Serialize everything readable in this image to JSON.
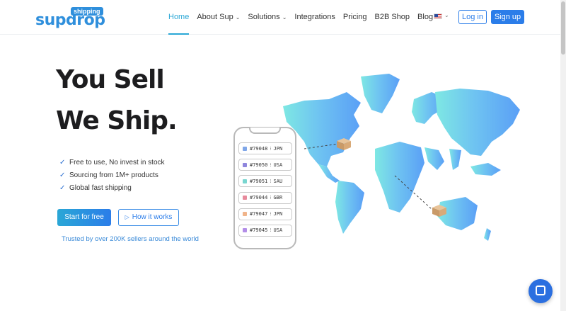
{
  "logo": {
    "brand": "supdrop",
    "tag": "shipping"
  },
  "nav": {
    "items": [
      {
        "label": "Home",
        "active": true,
        "dropdown": false
      },
      {
        "label": "About Sup",
        "active": false,
        "dropdown": true
      },
      {
        "label": "Solutions",
        "active": false,
        "dropdown": true
      },
      {
        "label": "Integrations",
        "active": false,
        "dropdown": false
      },
      {
        "label": "Pricing",
        "active": false,
        "dropdown": false
      },
      {
        "label": "B2B Shop",
        "active": false,
        "dropdown": false
      },
      {
        "label": "Blog",
        "active": false,
        "dropdown": false
      }
    ],
    "language_icon": "us-flag-icon",
    "login": "Log in",
    "signup": "Sign up"
  },
  "hero": {
    "line1": "You Sell",
    "line2": "We Ship.",
    "features": [
      "Free to use, No invest in stock",
      "Sourcing from 1M+ products",
      "Global fast shipping"
    ],
    "start_button": "Start for free",
    "how_button": "How it works",
    "trusted": "Trusted by over 200K sellers around the world"
  },
  "orders": [
    {
      "id": "#79048",
      "country": "JPN",
      "color": "#7fa6e8"
    },
    {
      "id": "#79050",
      "country": "USA",
      "color": "#8f86dd"
    },
    {
      "id": "#79051",
      "country": "SAU",
      "color": "#79d6d0"
    },
    {
      "id": "#79044",
      "country": "GBR",
      "color": "#e78a9c"
    },
    {
      "id": "#79047",
      "country": "JPN",
      "color": "#f0b48a"
    },
    {
      "id": "#79045",
      "country": "USA",
      "color": "#b38ee8"
    }
  ],
  "colors": {
    "accent": "#2b7de9",
    "active_nav": "#2aa7d6",
    "map_light": "#7ee3e8",
    "map_dark": "#5aa0f5"
  }
}
